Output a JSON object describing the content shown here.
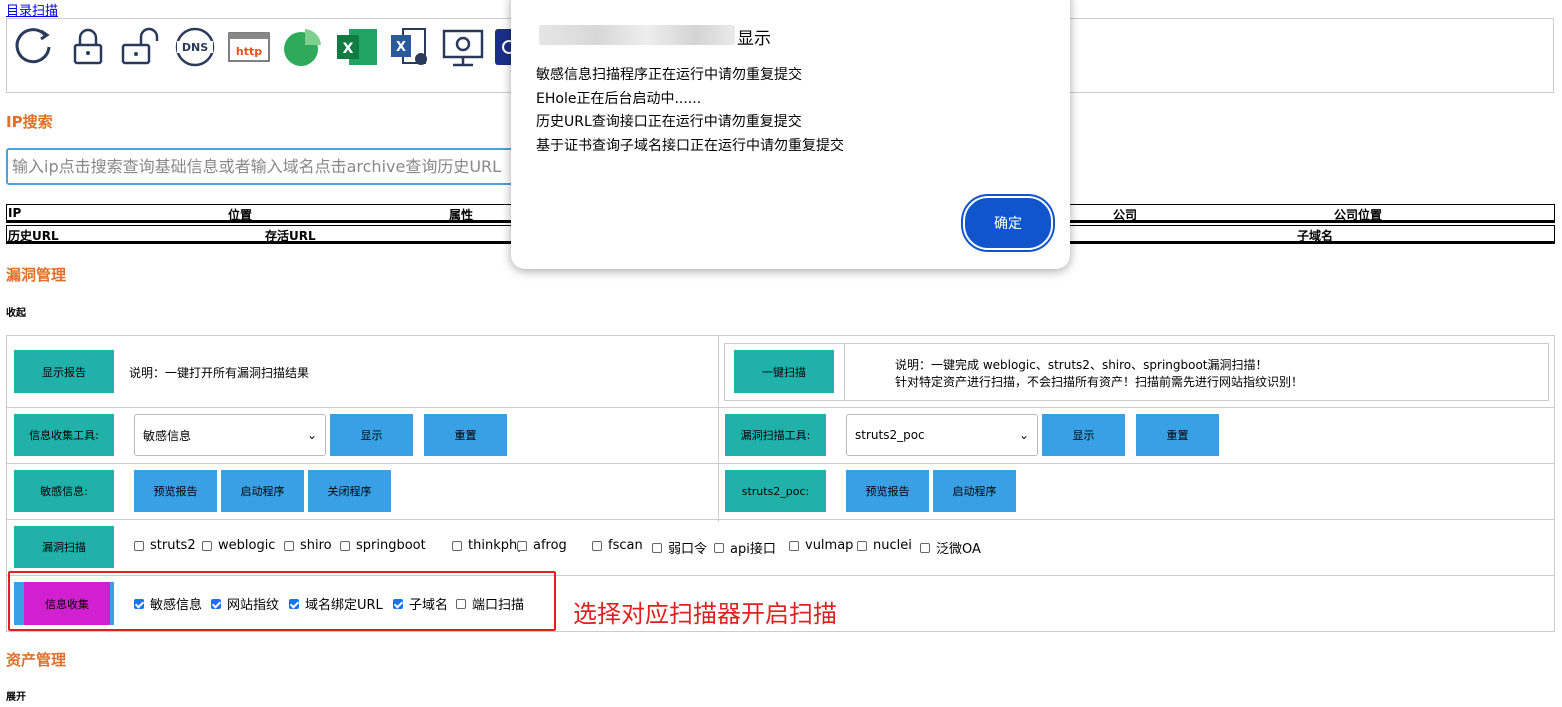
{
  "top_link": "目录扫描",
  "icons": [
    "refresh-icon",
    "unlock-icon",
    "lock-open-icon",
    "dns-icon",
    "http-icon",
    "pie-chart-icon",
    "excel-icon",
    "excel-export-icon",
    "monitor-settings-icon",
    "app-icon"
  ],
  "ip_section": {
    "title": "IP搜索",
    "placeholder": "输入ip点击搜索查询基础信息或者输入域名点击archive查询历史URL",
    "row1": [
      "IP",
      "位置",
      "属性",
      "公司",
      "公司位置"
    ],
    "row2": [
      "历史URL",
      "存活URL",
      "子域名"
    ]
  },
  "vuln_section": {
    "title": "漏洞管理",
    "collapse_label": "收起",
    "show_report_btn": "显示报告",
    "show_report_desc": "说明：一键打开所有漏洞扫描结果",
    "one_key_btn": "一键扫描",
    "one_key_desc_1": "说明：一键完成 weblogic、struts2、shiro、springboot漏洞扫描！",
    "one_key_desc_2": "针对特定资产进行扫描，不会扫描所有资产！扫描前需先进行网站指纹识别！",
    "info_tool_label": "信息收集工具:",
    "info_tool_selected": "敏感信息",
    "show_btn": "显示",
    "reset_btn": "重置",
    "vuln_tool_label": "漏洞扫描工具:",
    "vuln_tool_selected": "struts2_poc",
    "sensitive_label": "敏感信息:",
    "preview_report_btn": "预览报告",
    "start_program_btn": "启动程序",
    "close_program_btn": "关闭程序",
    "struts_label": "struts2_poc:",
    "vuln_scan_btn": "漏洞扫描",
    "vuln_checks": [
      {
        "label": "struts2",
        "checked": false
      },
      {
        "label": "weblogic",
        "checked": false
      },
      {
        "label": "shiro",
        "checked": false
      },
      {
        "label": "springboot",
        "checked": false
      },
      {
        "label": "thinkphp",
        "checked": false
      },
      {
        "label": "afrog",
        "checked": false
      },
      {
        "label": "fscan",
        "checked": false
      },
      {
        "label": "弱口令",
        "checked": false
      },
      {
        "label": "api接口",
        "checked": false
      },
      {
        "label": "vulmap",
        "checked": false
      },
      {
        "label": "nuclei",
        "checked": false
      },
      {
        "label": "泛微OA",
        "checked": false
      }
    ],
    "info_collect_btn": "信息收集",
    "info_checks": [
      {
        "label": "敏感信息",
        "checked": true
      },
      {
        "label": "网站指纹",
        "checked": true
      },
      {
        "label": "域名绑定URL",
        "checked": true
      },
      {
        "label": "子域名",
        "checked": true
      },
      {
        "label": "端口扫描",
        "checked": false
      }
    ],
    "annotation": "选择对应扫描器开启扫描"
  },
  "asset_section": {
    "title": "资产管理",
    "expand_label": "展开"
  },
  "dialog": {
    "title_suffix": "显示",
    "lines": [
      "敏感信息扫描程序正在运行中请勿重复提交",
      "EHole正在后台启动中......",
      "历史URL查询接口正在运行中请勿重复提交",
      "基于证书查询子域名接口正在运行中请勿重复提交"
    ],
    "ok_button": "确定"
  },
  "colors": {
    "accent": "#e0702a",
    "teal": "#20b2aa",
    "blue": "#3aa0e6",
    "magenta": "#d020d0",
    "annotation": "#e02020",
    "ok": "#1155cc"
  }
}
